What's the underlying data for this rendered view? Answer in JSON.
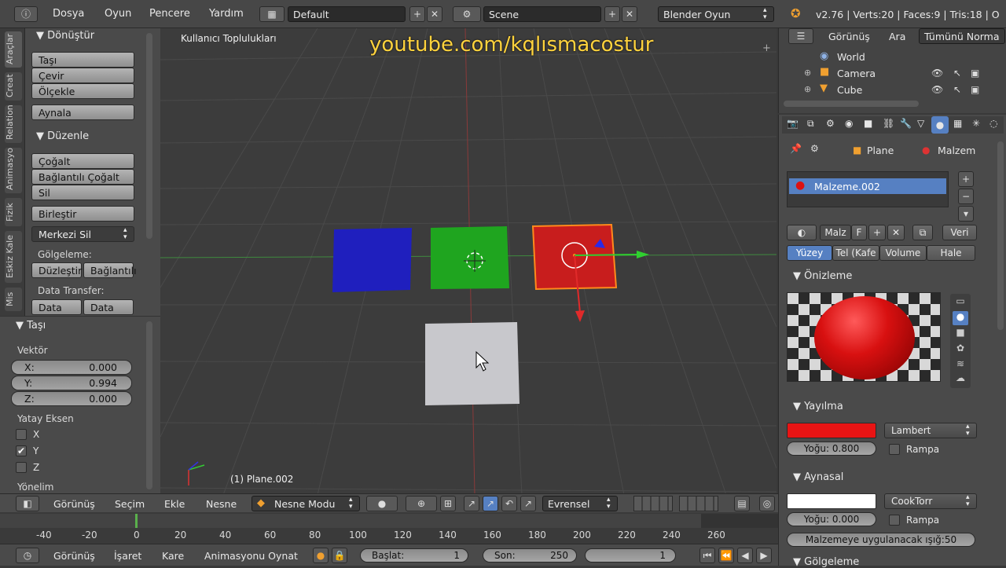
{
  "topbar": {
    "menus": [
      "Dosya",
      "Oyun",
      "Pencere",
      "Yardım"
    ],
    "layout": "Default",
    "scene": "Scene",
    "engine": "Blender Oyun",
    "stats": "v2.76 | Verts:20 | Faces:9 | Tris:18 | O"
  },
  "tooltabs": [
    "Araçlar",
    "Creat",
    "Relation",
    "Animasyo",
    "Fizik",
    "Eskiz Kale",
    "Mis"
  ],
  "toolshelf": {
    "transform_head": "Dönüştür",
    "transform_buttons": [
      "Taşı",
      "Çevir",
      "Ölçekle"
    ],
    "mirror": "Aynala",
    "edit_head": "Düzenle",
    "edit_buttons": [
      "Çoğalt",
      "Bağlantılı Çoğalt",
      "Sil"
    ],
    "join": "Birleştir",
    "origin": "Merkezi Sil",
    "shading_label": "Gölgeleme:",
    "shading_buttons": [
      "Düzleştir",
      "Bağlantılı"
    ],
    "data_transfer_label": "Data Transfer:",
    "data_transfer_buttons": [
      "Data",
      "Data Lay"
    ],
    "move_head": "Taşı",
    "vector_label": "Vektör",
    "vector": [
      {
        "axis": "X:",
        "value": "0.000"
      },
      {
        "axis": "Y:",
        "value": "0.994"
      },
      {
        "axis": "Z:",
        "value": "0.000"
      }
    ],
    "constraint_label": "Yatay Eksen",
    "constraints": [
      {
        "axis": "X",
        "checked": false
      },
      {
        "axis": "Y",
        "checked": true
      },
      {
        "axis": "Z",
        "checked": false
      }
    ],
    "orientation_label": "Yönelim"
  },
  "viewport": {
    "view_label": "Kullanıcı Toplulukları",
    "object_label": "(1) Plane.002",
    "watermark": "youtube.com/kqlısmacostur",
    "colors": {
      "blue": "#1f1fbe",
      "green": "#1fa51f",
      "red": "#c81d1d",
      "white": "#c8c8cc",
      "select": "#ff8a1c"
    }
  },
  "vpheader": {
    "items": [
      "Görünüş",
      "Seçim",
      "Ekle",
      "Nesne"
    ],
    "mode": "Nesne Modu",
    "orientation": "Evrensel"
  },
  "timeline": {
    "ticks": [
      "-40",
      "-20",
      "0",
      "20",
      "40",
      "60",
      "80",
      "100",
      "120",
      "140",
      "160",
      "180",
      "200",
      "220",
      "240",
      "260"
    ],
    "footer_items": [
      "Görünüş",
      "İşaret",
      "Kare",
      "Animasyonu Oynat"
    ],
    "start_label": "Başlat:",
    "start": "1",
    "end_label": "Son:",
    "end": "250",
    "current": "1"
  },
  "outliner": {
    "tabs": [
      "Görünüş",
      "Ara",
      "Tümünü Norma"
    ],
    "rows": [
      "World",
      "Camera",
      "Cube"
    ]
  },
  "properties": {
    "breadcrumb": [
      "Plane",
      "Malzem"
    ],
    "material_slot": "Malzeme.002",
    "material_row": [
      "Malz",
      "F",
      "Veri"
    ],
    "tabs": [
      "Yüzey",
      "Tel (Kafe",
      "Volume",
      "Hale"
    ],
    "preview_head": "Önizleme",
    "diffuse_head": "Yayılma",
    "diffuse_shader": "Lambert",
    "diffuse_intensity": "Yoğu: 0.800",
    "ramp": "Rampa",
    "specular_head": "Aynasal",
    "specular_shader": "CookTorr",
    "specular_intensity": "Yoğu: 0.000",
    "specular_ramp": "Rampa",
    "light_field": "Malzemeye uygulanacak ışığ:50",
    "shading_head": "Gölgeleme",
    "diffuse_color": "#e81414",
    "specular_color": "#ffffff"
  }
}
